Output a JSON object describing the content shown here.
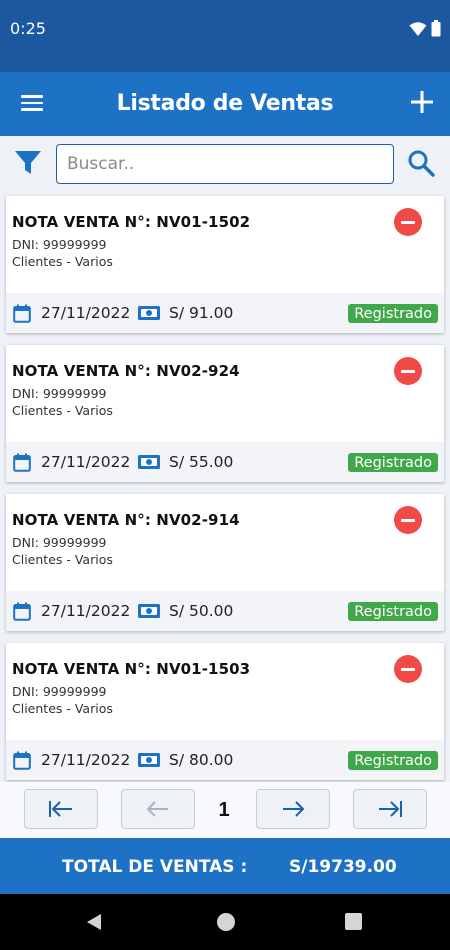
{
  "status_bar": {
    "time": "0:25"
  },
  "app_bar": {
    "title": "Listado de Ventas"
  },
  "search": {
    "placeholder": "Buscar.."
  },
  "sales": [
    {
      "title": "NOTA VENTA N°: NV01-1502",
      "dni": "DNI: 99999999",
      "client": "Clientes - Varios",
      "date": "27/11/2022",
      "amount": "S/ 91.00",
      "status": "Registrado"
    },
    {
      "title": "NOTA VENTA N°: NV02-924",
      "dni": "DNI: 99999999",
      "client": "Clientes - Varios",
      "date": "27/11/2022",
      "amount": "S/ 55.00",
      "status": "Registrado"
    },
    {
      "title": "NOTA VENTA N°: NV02-914",
      "dni": "DNI: 99999999",
      "client": "Clientes - Varios",
      "date": "27/11/2022",
      "amount": "S/ 50.00",
      "status": "Registrado"
    },
    {
      "title": "NOTA VENTA N°: NV01-1503",
      "dni": "DNI: 99999999",
      "client": "Clientes - Varios",
      "date": "27/11/2022",
      "amount": "S/ 80.00",
      "status": "Registrado"
    }
  ],
  "pagination": {
    "current_page": "1"
  },
  "totals": {
    "label": "TOTAL DE VENTAS :",
    "value": "S/19739.00"
  },
  "colors": {
    "primary": "#1d72c6",
    "status_bar": "#1c58a0",
    "badge": "#40a84b",
    "remove": "#ef4a45"
  },
  "icons": [
    "wifi-icon",
    "battery-icon",
    "menu-icon",
    "plus-icon",
    "filter-icon",
    "search-icon",
    "minus-circle-icon",
    "calendar-icon",
    "money-icon",
    "first-page-icon",
    "prev-page-icon",
    "next-page-icon",
    "last-page-icon",
    "nav-back-icon",
    "nav-home-icon",
    "nav-recents-icon"
  ]
}
